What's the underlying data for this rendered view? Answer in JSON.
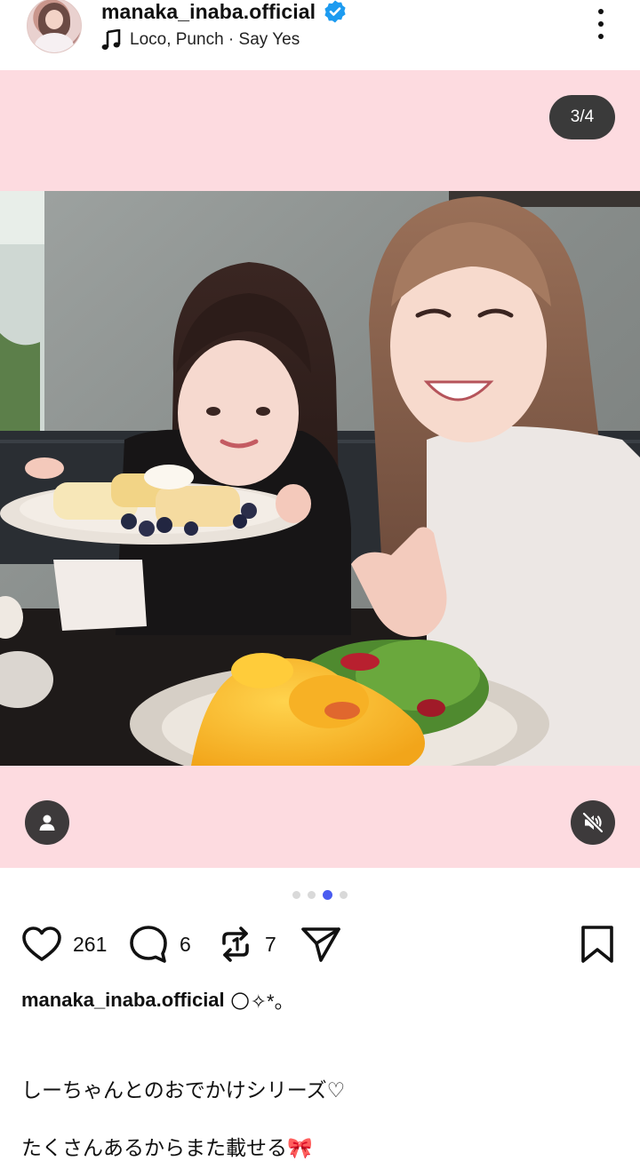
{
  "header": {
    "username": "manaka_inaba.official",
    "music": "Loco, Punch · Say Yes"
  },
  "media": {
    "counter": "3/4",
    "current_slide": 3,
    "total_slides": 4
  },
  "actions": {
    "likes": "261",
    "comments": "6",
    "reposts": "7"
  },
  "caption": {
    "username": "manaka_inaba.official",
    "emoji": "🌕✧*。",
    "line1": "しーちゃんとのおでかけシリーズ♡",
    "line2": "たくさんあるからまた載せる🎀"
  },
  "colors": {
    "media_background": "#fddbe0",
    "active_dot": "#4a5cf0",
    "verified_badge": "#1d9bf0"
  }
}
